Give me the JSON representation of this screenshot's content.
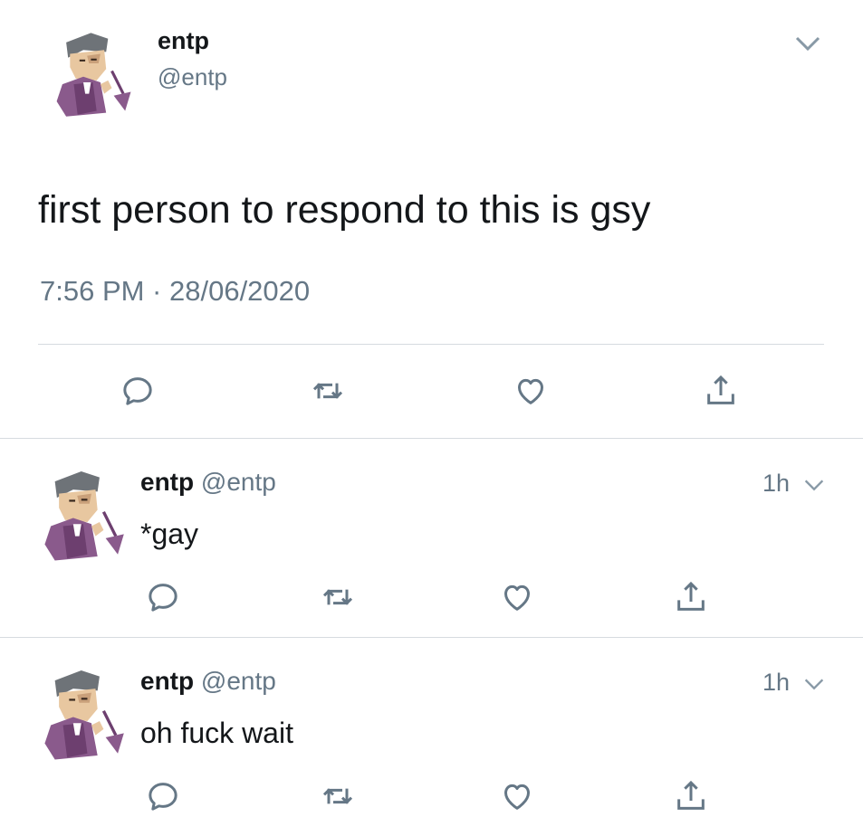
{
  "main_tweet": {
    "display_name": "entp",
    "handle": "@entp",
    "text": "first person to respond to this is gsy",
    "timestamp": "7:56 PM · 28/06/2020"
  },
  "replies": [
    {
      "display_name": "entp",
      "handle": "@entp",
      "text": "*gay",
      "age": "1h"
    },
    {
      "display_name": "entp",
      "handle": "@entp",
      "text": "oh fuck wait",
      "age": "1h"
    }
  ],
  "icons": {
    "reply": "reply-icon",
    "retweet": "retweet-icon",
    "like": "heart-icon",
    "share": "share-icon",
    "menu": "chevron-down-icon",
    "avatar": "avatar-image"
  },
  "colors": {
    "text": "#14171a",
    "secondary": "#657786",
    "divider": "#d6dbe0",
    "avatar_purple": "#8a5a8c"
  }
}
